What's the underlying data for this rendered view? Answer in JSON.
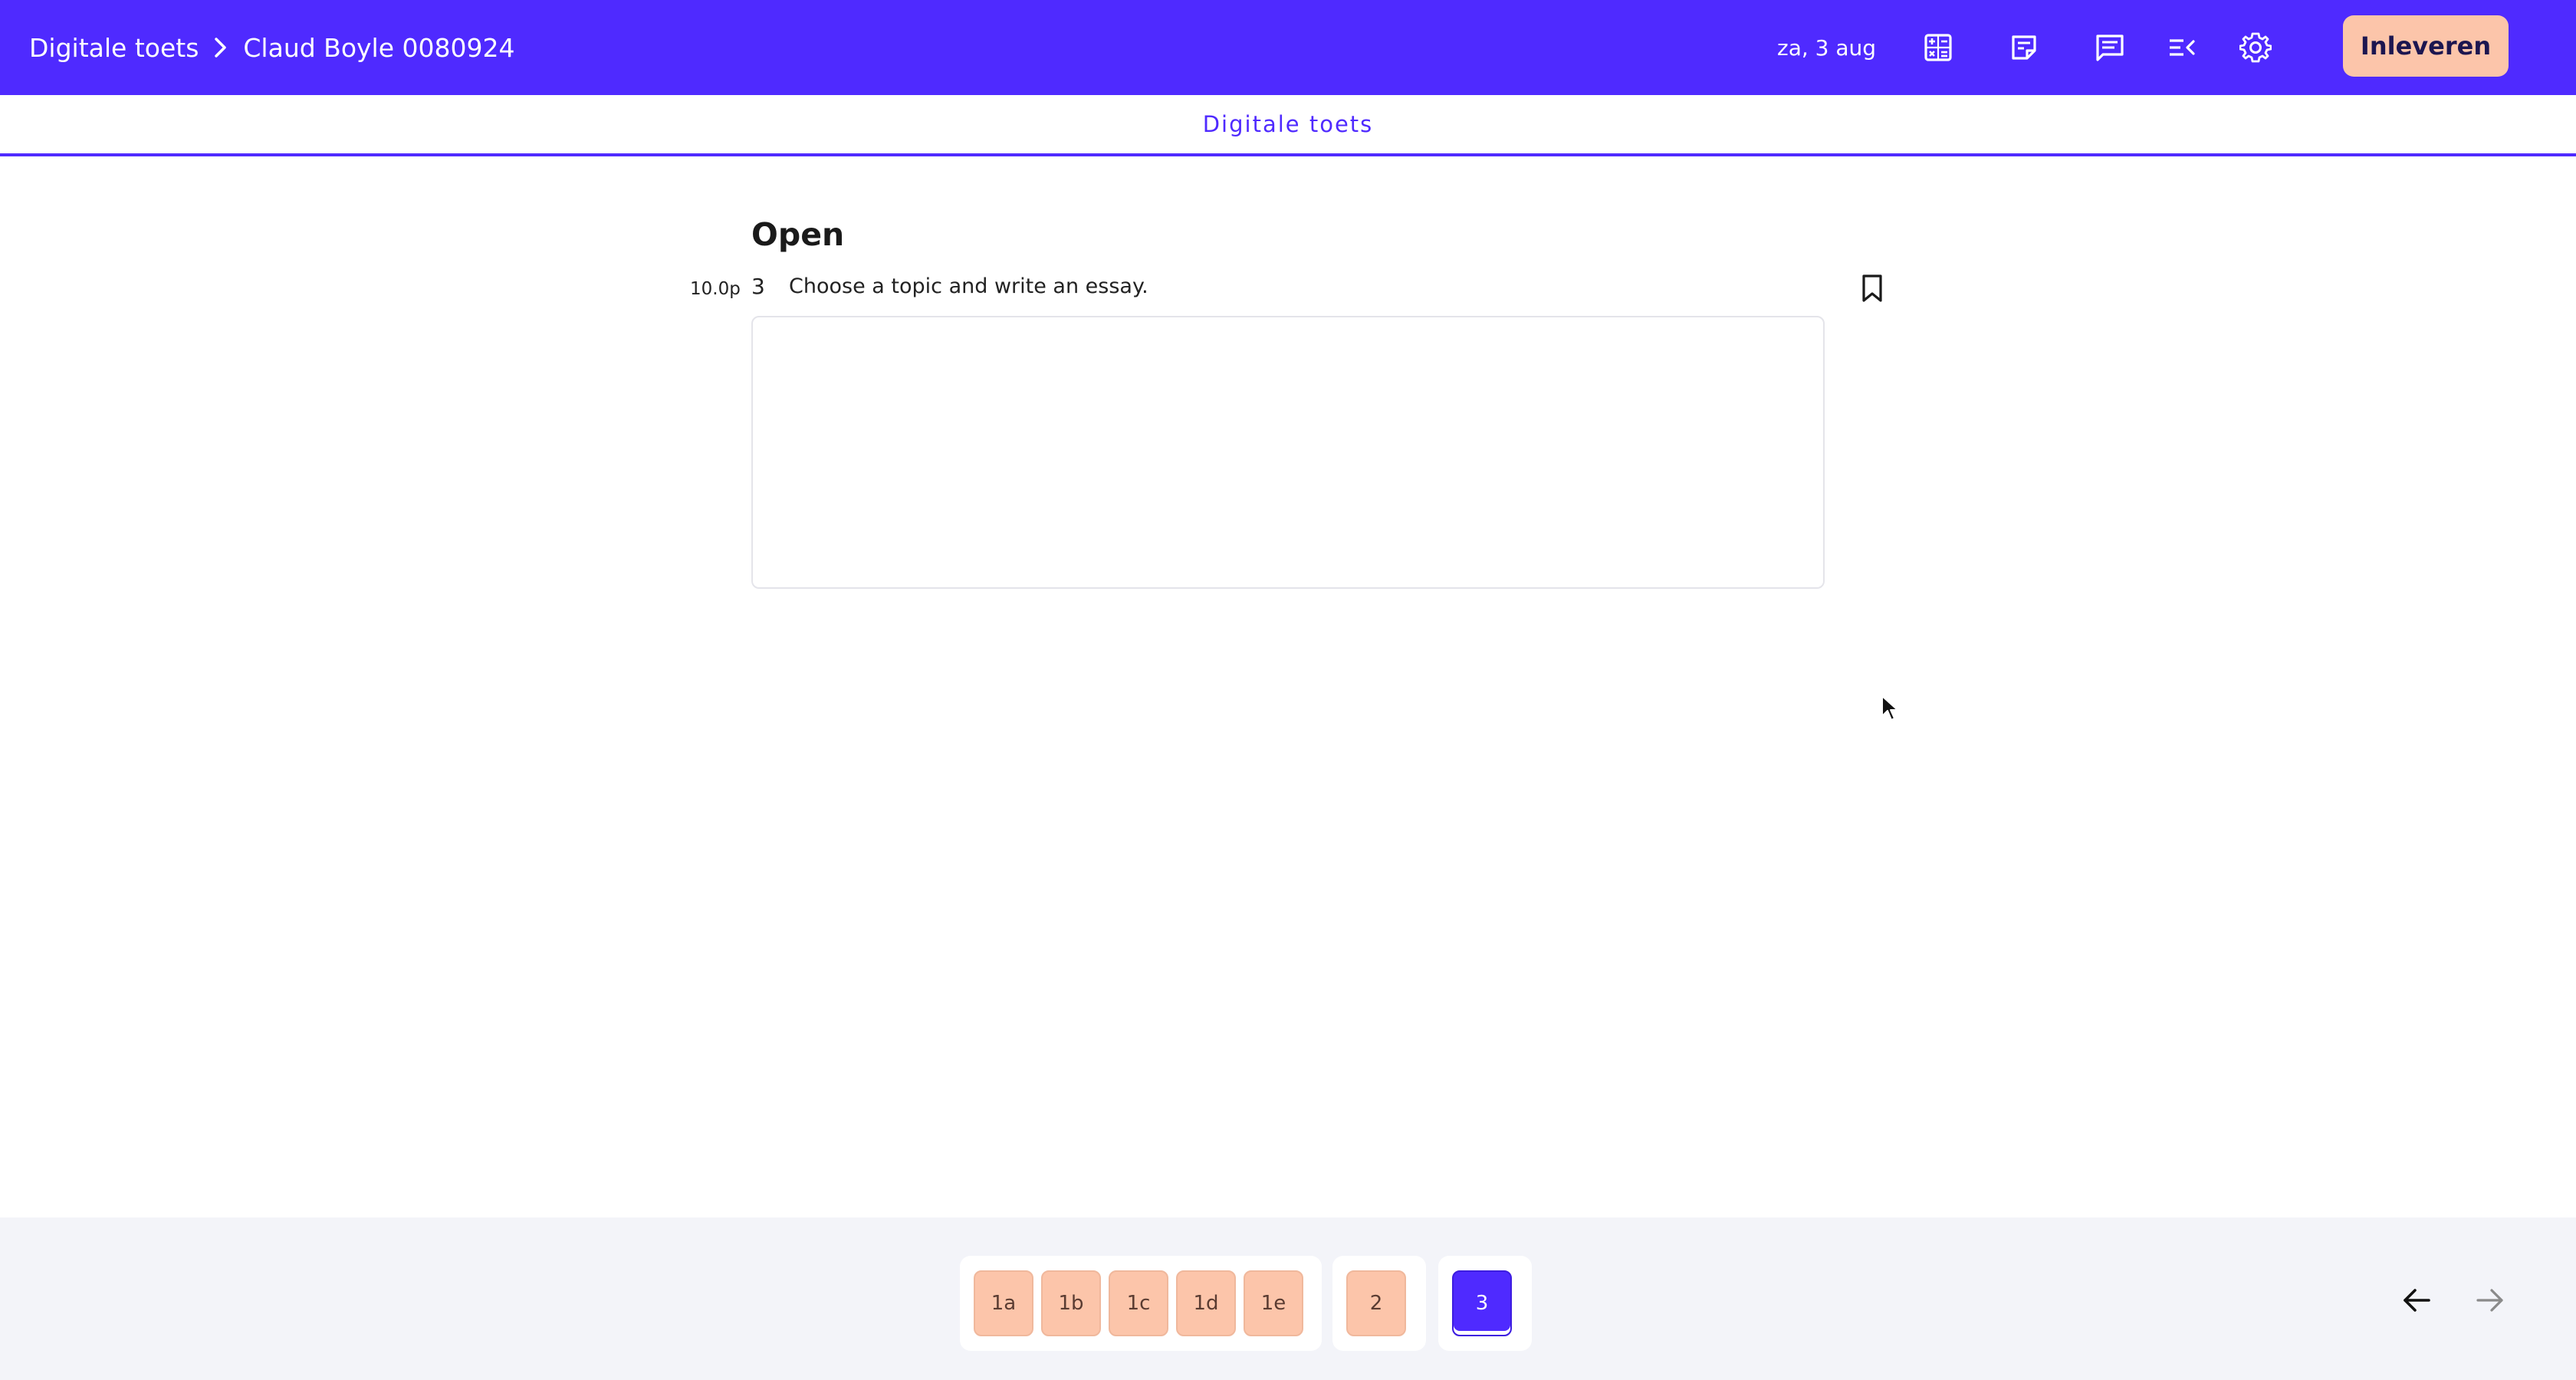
{
  "header": {
    "breadcrumb_root": "Digitale toets",
    "breadcrumb_current": "Claud Boyle 0080924",
    "date": "za, 3 aug",
    "submit_label": "Inleveren",
    "icons": [
      "calculator-icon",
      "notes-icon",
      "comments-icon",
      "collapse-list-icon",
      "gear-icon"
    ]
  },
  "tabs": {
    "active_label": "Digitale toets"
  },
  "question": {
    "section_title": "Open",
    "points": "10.0p",
    "number": "3",
    "text": "Choose a topic and write an essay.",
    "answer_value": ""
  },
  "navigation": {
    "groups": [
      [
        "1a",
        "1b",
        "1c",
        "1d",
        "1e"
      ],
      [
        "2"
      ],
      [
        "3"
      ]
    ],
    "active": "3"
  },
  "colors": {
    "brand": "#4f2aff",
    "answered": "#fcc5aa",
    "background": "#f3f4f9"
  }
}
